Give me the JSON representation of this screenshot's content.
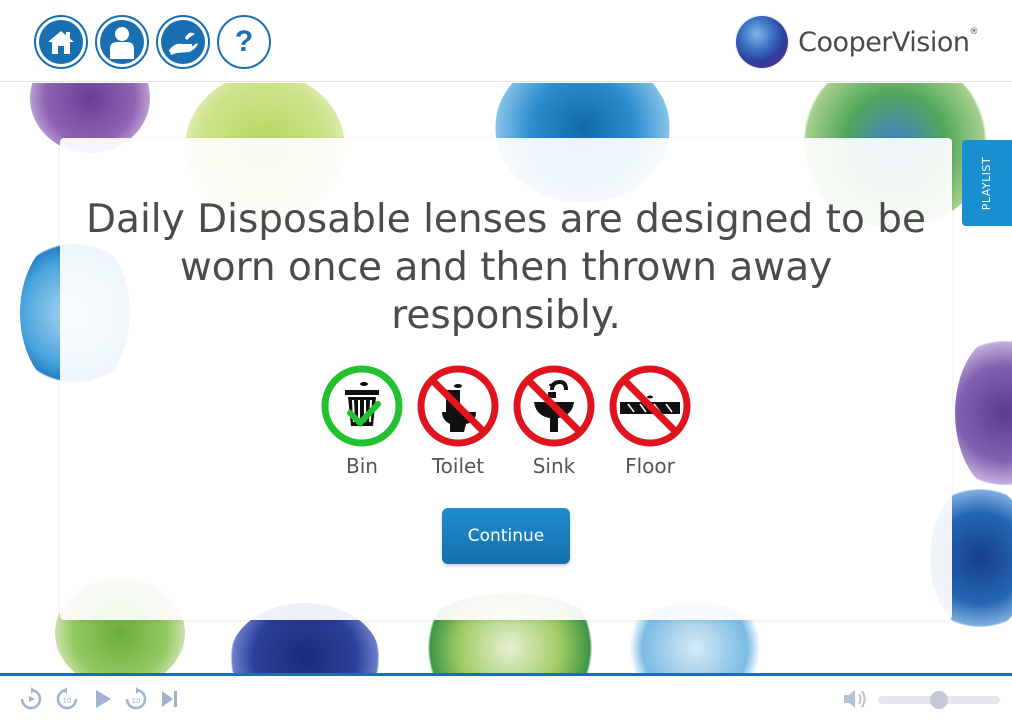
{
  "header": {
    "nav_buttons": [
      {
        "name": "home-icon"
      },
      {
        "name": "user-icon"
      },
      {
        "name": "hand-icon"
      },
      {
        "name": "help-icon",
        "label": "?"
      }
    ],
    "brand": {
      "name": "CooperVision",
      "registered": "®"
    }
  },
  "card": {
    "headline": "Daily Disposable lenses are designed to be worn once and then thrown away responsibly.",
    "options": [
      {
        "label": "Bin",
        "icon": "bin-icon",
        "status": "allowed",
        "color": "#22c12e"
      },
      {
        "label": "Toilet",
        "icon": "toilet-icon",
        "status": "prohibited",
        "color": "#e0141e"
      },
      {
        "label": "Sink",
        "icon": "sink-icon",
        "status": "prohibited",
        "color": "#e0141e"
      },
      {
        "label": "Floor",
        "icon": "floor-icon",
        "status": "prohibited",
        "color": "#e0141e"
      }
    ],
    "continue_label": "Continue"
  },
  "sidebar": {
    "playlist_label": "PLAYLIST"
  },
  "player": {
    "controls": [
      "replay-icon",
      "rewind-10-icon",
      "play-icon",
      "forward-10-icon",
      "skip-end-icon"
    ],
    "skip_seconds": "10",
    "volume": 0.5
  },
  "colors": {
    "accent": "#1a6fb3",
    "button": "#1a7fc0",
    "allowed": "#22c12e",
    "prohibited": "#e0141e"
  }
}
